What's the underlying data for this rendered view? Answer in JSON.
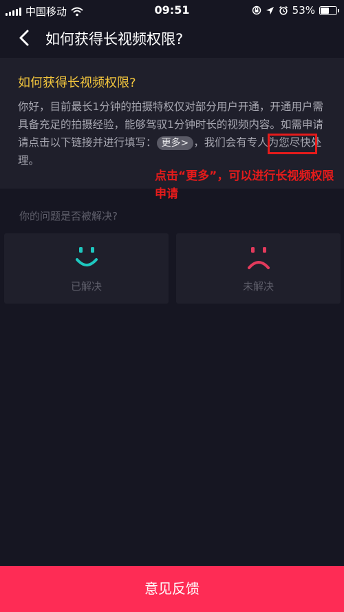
{
  "status_bar": {
    "carrier": "中国移动",
    "time": "09:51",
    "battery": "53%"
  },
  "nav": {
    "title": "如何获得长视频权限?"
  },
  "answer": {
    "title": "如何获得长视频权限?",
    "body_text": "你好，目前最长1分钟的拍摄特权仅对部分用户开通，开通用户需具备充足的拍摄经验，能够驾驭1分钟时长的视频内容。如需申请请点击以下链接并进行填写：",
    "more_link": "更多>",
    "body_tail": "，我们会有专人为您尽快处理。"
  },
  "annotation": {
    "text": "点击“更多”，可以进行长视频权限申请",
    "color": "#e51b1b"
  },
  "feedback": {
    "question": "你的问题是否被解决?",
    "solved_label": "已解决",
    "unsolved_label": "未解决",
    "solved_color": "#1ec8c0",
    "unsolved_color": "#e33a5c"
  },
  "bottom": {
    "button_label": "意见反馈",
    "color": "#fe2c55"
  }
}
